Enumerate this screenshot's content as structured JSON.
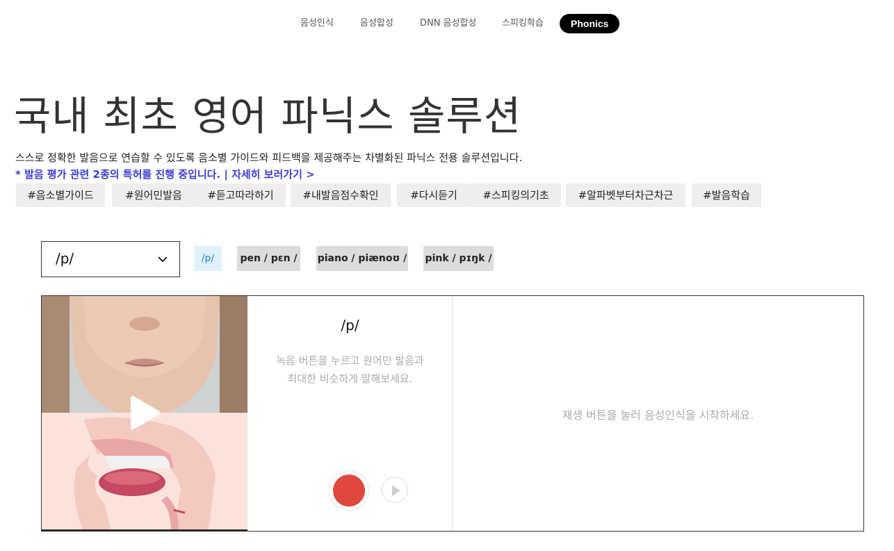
{
  "nav": {
    "items": [
      {
        "label": "음성인식"
      },
      {
        "label": "음성합성"
      },
      {
        "label": "DNN 음성합성"
      },
      {
        "label": "스피킹학습"
      },
      {
        "label": "Phonics"
      }
    ],
    "active_index": 4
  },
  "hero": {
    "title": "국내 최초 영어 파닉스 솔루션",
    "description": "스스로 정확한 발음으로 연습할 수 있도록 음소별 가이드와 피드백을 제공해주는 차별화된 파닉스 전용 솔루션입니다.",
    "patent_text": "* 발음 평가 관련 2종의 특허를 진행 중입니다. | ",
    "patent_link": "자세히 보러가기 >",
    "tags": [
      "#음소별가이드",
      "#원어민발음",
      "#듣고따라하기",
      "#내발음점수확인",
      "#다시듣기",
      "#스피킹의기초",
      "#알파벳부터차근차근",
      "#발음학습"
    ]
  },
  "selector": {
    "value": "/p/",
    "chips": [
      {
        "label": "/p/",
        "active": true
      },
      {
        "label": "pen / pɛn /",
        "active": false
      },
      {
        "label": "piano / piænoʊ /",
        "active": false
      },
      {
        "label": "pink / pɪŋk /",
        "active": false
      }
    ]
  },
  "practice": {
    "phoneme": "/p/",
    "instruction": "녹음 버튼을 누르고 원어민 발음과 최대한 비슷하게 말해보세요.",
    "result_message": "재생 버튼을 눌러 음성인식을 시작하세요."
  },
  "colors": {
    "accent_blue": "#3b3bd8",
    "record_red": "#e0473f",
    "chip_active_bg": "#dff1fc",
    "chip_active_text": "#2e86c1"
  },
  "icons": {
    "select": "chevron-down-icon",
    "media": "play-icon",
    "record": "record-icon",
    "replay": "replay-icon"
  }
}
